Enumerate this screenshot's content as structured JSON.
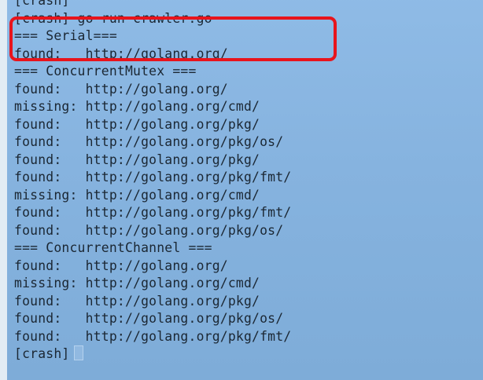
{
  "terminal": {
    "prompt_label": "[crash]",
    "lines": [
      "[crash]",
      "[crash] go run crawler.go",
      "=== Serial===",
      "found:   http://golang.org/",
      "=== ConcurrentMutex ===",
      "found:   http://golang.org/",
      "missing: http://golang.org/cmd/",
      "found:   http://golang.org/pkg/",
      "found:   http://golang.org/pkg/os/",
      "found:   http://golang.org/pkg/",
      "found:   http://golang.org/pkg/fmt/",
      "missing: http://golang.org/cmd/",
      "found:   http://golang.org/pkg/fmt/",
      "found:   http://golang.org/pkg/os/",
      "=== ConcurrentChannel ===",
      "found:   http://golang.org/",
      "missing: http://golang.org/cmd/",
      "found:   http://golang.org/pkg/",
      "found:   http://golang.org/pkg/os/",
      "found:   http://golang.org/pkg/fmt/"
    ]
  },
  "annotation": {
    "highlight_color": "#e8141c"
  }
}
